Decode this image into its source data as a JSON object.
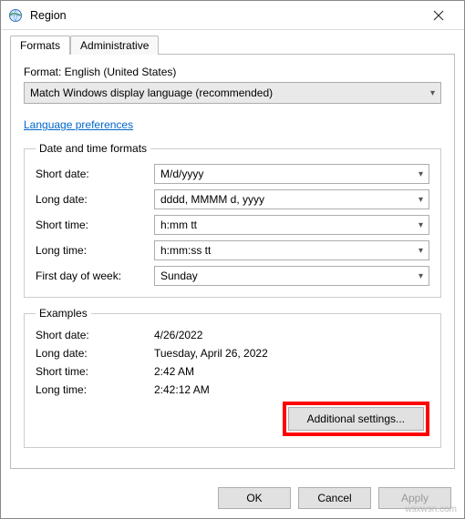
{
  "window": {
    "title": "Region"
  },
  "tabs": {
    "formats": "Formats",
    "administrative": "Administrative"
  },
  "format": {
    "label": "Format: English (United States)",
    "selected": "Match Windows display language (recommended)"
  },
  "link": {
    "language_preferences": "Language preferences"
  },
  "datetime_group": {
    "legend": "Date and time formats",
    "short_date_label": "Short date:",
    "short_date_value": "M/d/yyyy",
    "long_date_label": "Long date:",
    "long_date_value": "dddd, MMMM d, yyyy",
    "short_time_label": "Short time:",
    "short_time_value": "h:mm tt",
    "long_time_label": "Long time:",
    "long_time_value": "h:mm:ss tt",
    "first_day_label": "First day of week:",
    "first_day_value": "Sunday"
  },
  "examples_group": {
    "legend": "Examples",
    "short_date_label": "Short date:",
    "short_date_value": "4/26/2022",
    "long_date_label": "Long date:",
    "long_date_value": "Tuesday, April 26, 2022",
    "short_time_label": "Short time:",
    "short_time_value": "2:42 AM",
    "long_time_label": "Long time:",
    "long_time_value": "2:42:12 AM"
  },
  "buttons": {
    "additional": "Additional settings...",
    "ok": "OK",
    "cancel": "Cancel",
    "apply": "Apply"
  },
  "watermark": "wsxwsn.com"
}
